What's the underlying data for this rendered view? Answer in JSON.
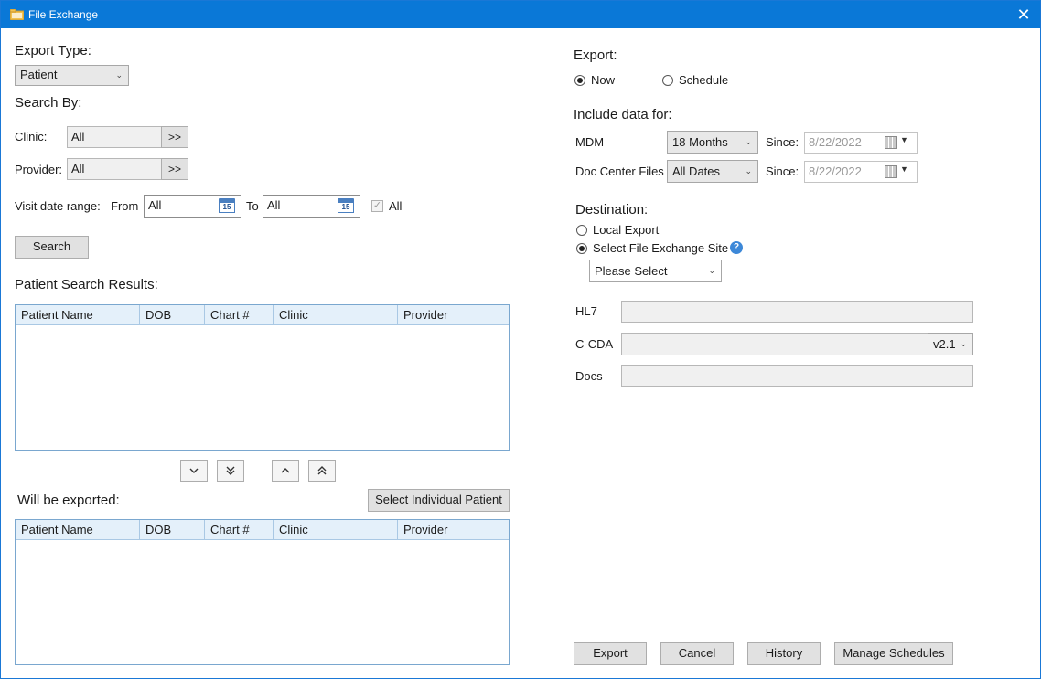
{
  "window": {
    "title": "File Exchange",
    "close_glyph": "✕"
  },
  "left": {
    "export_type_label": "Export Type:",
    "export_type_value": "Patient",
    "search_by_label": "Search By:",
    "clinic_label": "Clinic:",
    "clinic_value": "All",
    "provider_label": "Provider:",
    "provider_value": "All",
    "picker_button": ">>",
    "visit_range_label": "Visit date range:",
    "from_label": "From",
    "from_value": "All",
    "to_label": "To",
    "to_value": "All",
    "calendar_day": "15",
    "all_checkbox_label": "All",
    "all_checked": true,
    "search_button": "Search",
    "results_label": "Patient Search Results:",
    "columns": [
      "Patient Name",
      "DOB",
      "Chart #",
      "Clinic",
      "Provider"
    ],
    "nav": {
      "down": "⌄",
      "down_all": "⩔",
      "up": "⌃",
      "up_all": "⩓"
    },
    "will_export_label": "Will be exported:",
    "select_individual_button": "Select Individual Patient"
  },
  "right": {
    "export_label": "Export:",
    "now_label": "Now",
    "schedule_label": "Schedule",
    "now_selected": true,
    "include_label": "Include data for:",
    "mdm_label": "MDM",
    "mdm_value": "18 Months",
    "since_label": "Since:",
    "mdm_since": "8/22/2022",
    "doc_center_label": "Doc Center Files",
    "doc_center_value": "All Dates",
    "doc_since": "8/22/2022",
    "destination_label": "Destination:",
    "local_export_label": "Local Export",
    "select_site_label": "Select File Exchange Site",
    "site_selected": true,
    "help_glyph": "?",
    "site_value": "Please Select",
    "hl7_label": "HL7",
    "ccda_label": "C-CDA",
    "ccda_version": "v2.1",
    "docs_label": "Docs"
  },
  "footer": {
    "export_button": "Export",
    "cancel_button": "Cancel",
    "history_button": "History",
    "manage_button": "Manage Schedules"
  },
  "colors": {
    "titlebar": "#0a78d7",
    "table_header": "#e4f0fa",
    "accent": "#3d88d8"
  }
}
